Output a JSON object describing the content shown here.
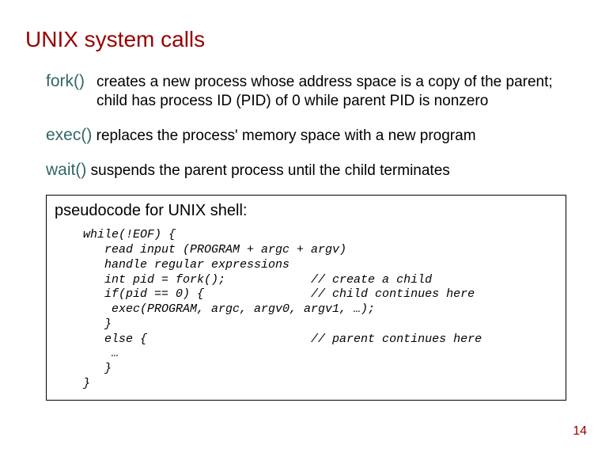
{
  "title": "UNIX system calls",
  "calls": {
    "fork": {
      "name": "fork()",
      "desc": "creates a new process whose address space is a copy of the parent; child has process ID (PID) of 0 while parent PID is nonzero"
    },
    "exec": {
      "name": "exec()",
      "desc": "replaces the process' memory space with a new program"
    },
    "wait": {
      "name": "wait()",
      "desc": "suspends the parent process until the child terminates"
    }
  },
  "codebox": {
    "title": "pseudocode for UNIX shell:",
    "code": "while(!EOF) {\n   read input (PROGRAM + argc + argv)\n   handle regular expressions\n   int pid = fork();            // create a child\n   if(pid == 0) {               // child continues here\n    exec(PROGRAM, argc, argv0, argv1, …);\n   }\n   else {                       // parent continues here\n    …\n   }\n}"
  },
  "page_number": "14"
}
